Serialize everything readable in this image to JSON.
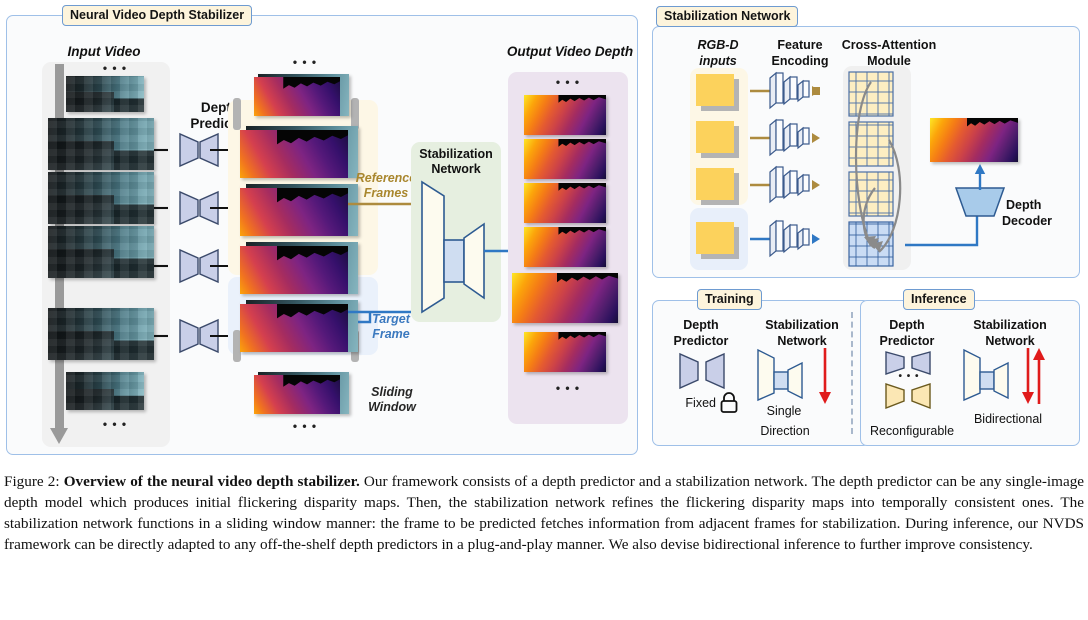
{
  "figure": {
    "number": "Figure 2:",
    "title": "Overview of the neural video depth stabilizer.",
    "body": "Our framework consists of a depth predictor and a stabilization network. The depth predictor can be any single-image depth model which produces initial flickering disparity maps. Then, the stabilization network refines the flickering disparity maps into temporally consistent ones. The stabilization network functions in a sliding window manner: the frame to be predicted fetches information from adjacent frames for stabilization. During inference, our NVDS framework can be directly adapted to any off-the-shelf depth predictors in a plug-and-play manner. We also devise bidirectional inference to further improve consistency."
  },
  "panels": {
    "overview": {
      "tab": "Neural Video Depth Stabilizer"
    },
    "stabilization": {
      "tab": "Stabilization Network"
    },
    "training": {
      "tab": "Training"
    },
    "inference": {
      "tab": "Inference"
    }
  },
  "overview": {
    "input_video_label": "Input Video",
    "depth_predictor_label": "Depth\nPredictor",
    "depth_predictor_line1": "Depth",
    "depth_predictor_line2": "Predictor",
    "reference_frames_line1": "Reference",
    "reference_frames_line2": "Frames",
    "target_frame_line1": "Target",
    "target_frame_line2": "Frame",
    "sliding_window_line1": "Sliding",
    "sliding_window_line2": "Window",
    "stabilization_network_line1": "Stabilization",
    "stabilization_network_line2": "Network",
    "output_video_depth_label": "Output Video Depth",
    "ellipsis": "• • •"
  },
  "stabilization_detail": {
    "rgbd_inputs_line1": "RGB-D",
    "rgbd_inputs_line2": "inputs",
    "feature_encoding_line1": "Feature",
    "feature_encoding_line2": "Encoding",
    "cross_attention_line1": "Cross-Attention",
    "cross_attention_line2": "Module",
    "depth_decoder_line1": "Depth",
    "depth_decoder_line2": "Decoder"
  },
  "training": {
    "depth_predictor_line1": "Depth",
    "depth_predictor_line2": "Predictor",
    "stabilization_network_line1": "Stabilization",
    "stabilization_network_line2": "Network",
    "predictor_state": "Fixed",
    "lock_icon": "lock-icon",
    "direction_line1": "Single",
    "direction_line2": "Direction"
  },
  "inference": {
    "depth_predictor_line1": "Depth",
    "depth_predictor_line2": "Predictor",
    "stabilization_network_line1": "Stabilization",
    "stabilization_network_line2": "Network",
    "predictor_state": "Reconfigurable",
    "ellipsis": "• • •",
    "direction": "Bidirectional"
  },
  "colors": {
    "panel_border": "#9fc0e8",
    "tab_fill": "#fdf4dc",
    "tab_border": "#6e9bd1",
    "reference_tint": "#fdf7e6",
    "target_tint": "#eaf1fb",
    "output_tint": "#ece3ef",
    "stabnet_tint": "#e6efe0",
    "reference_arrow": "#ad8b3f",
    "target_arrow": "#2f78c4",
    "rgbd_yellow": "#fcd25c",
    "attention_arrow": "#8a8a8a",
    "direction_arrow": "#e01b1b",
    "trapezoid_fill": "#c9cfe8",
    "decoder_fill": "#a8cbea"
  }
}
